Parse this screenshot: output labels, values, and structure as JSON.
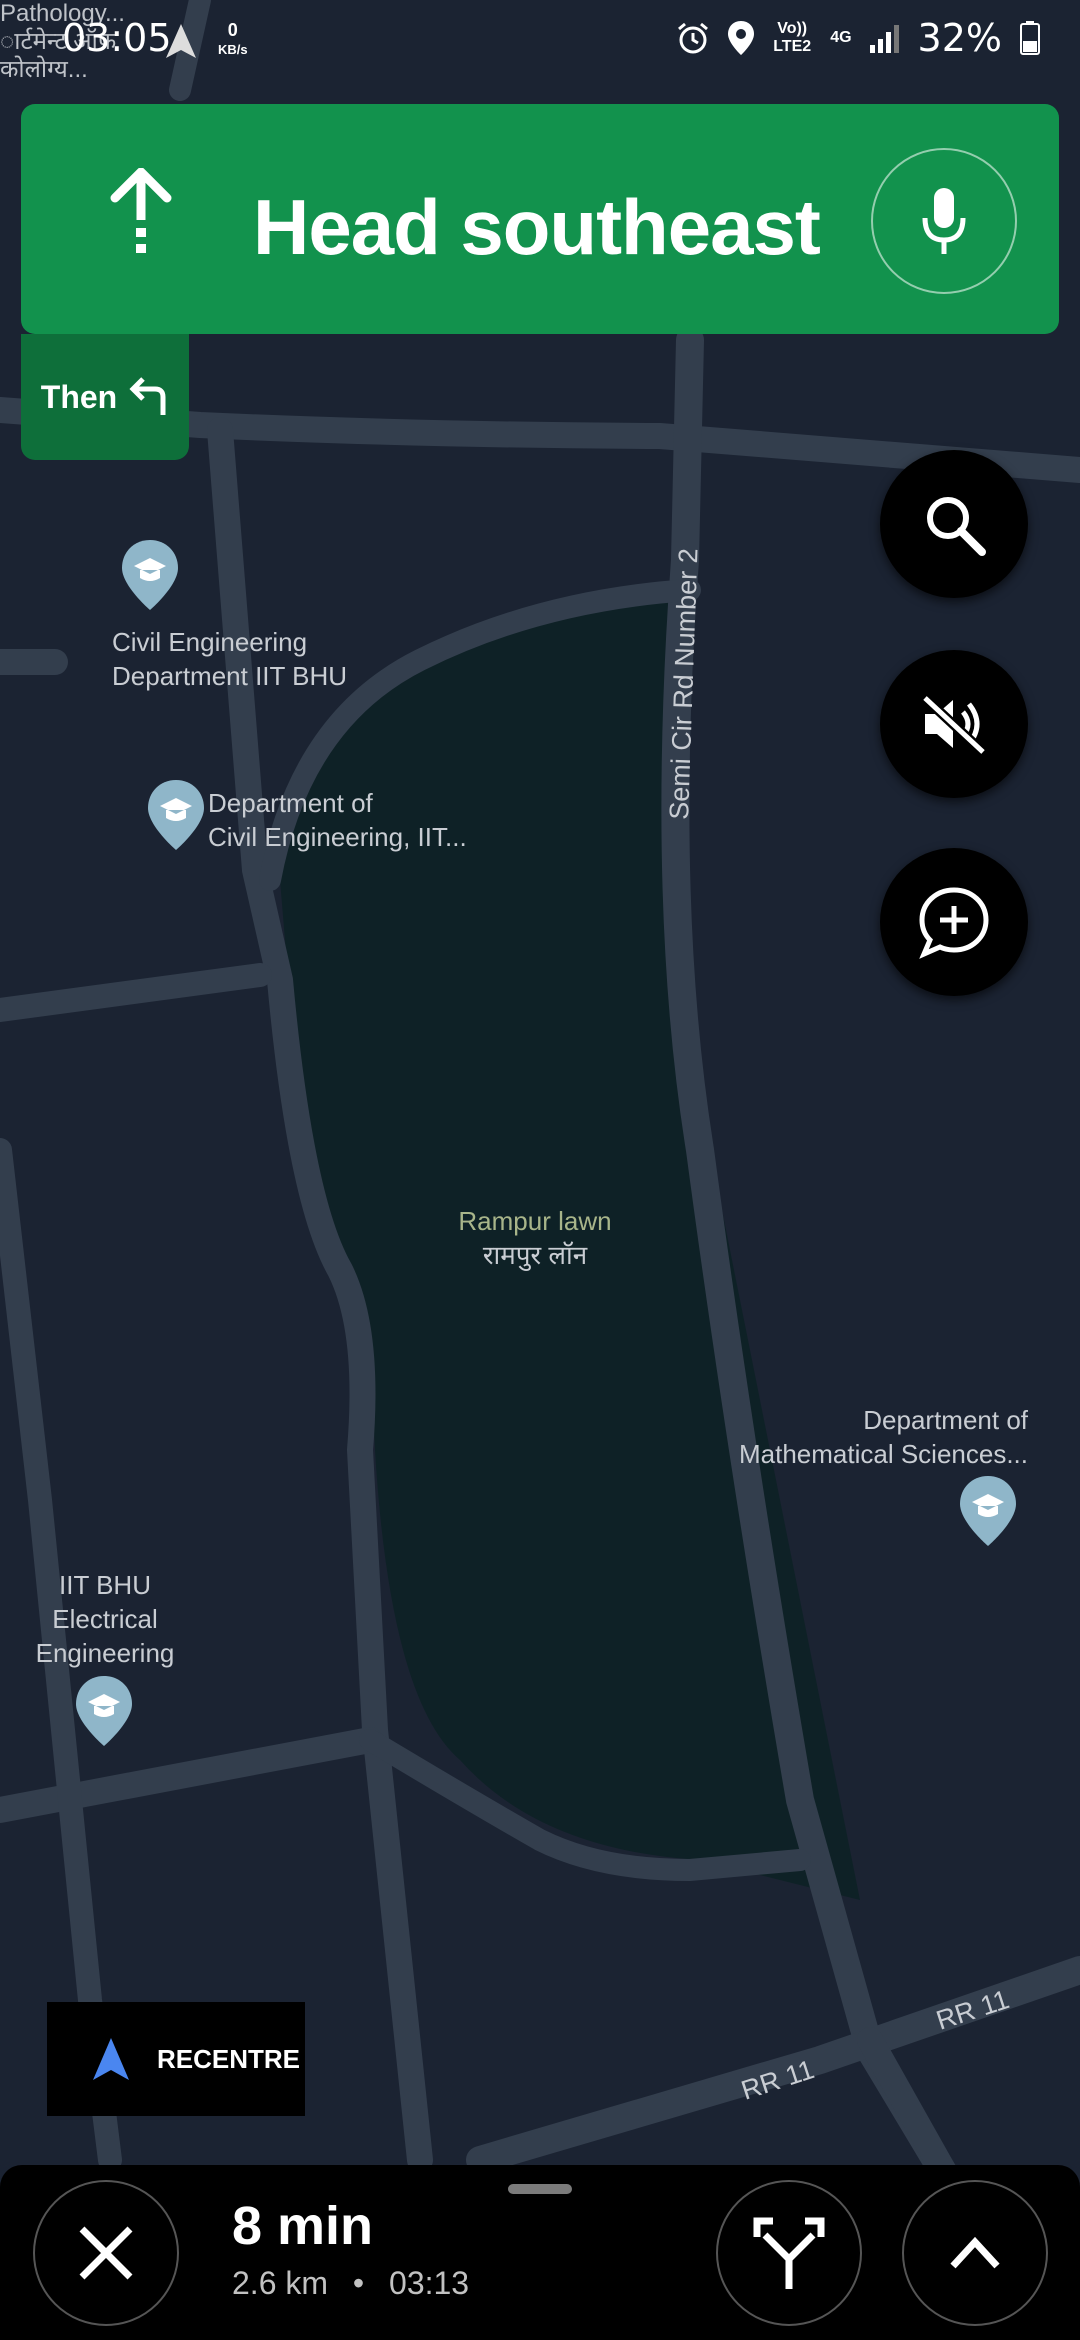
{
  "status_bar": {
    "time": "03:05",
    "speed_value": "0",
    "speed_unit": "KB/s",
    "faded_text": [
      "Pathology...",
      "ार्टमेन्ट ऑफ़",
      "कोलोग्य..."
    ],
    "volte": "Vo)) LTE2",
    "network": "4G",
    "battery": "32%"
  },
  "navigation": {
    "instruction": "Head southeast",
    "then_label": "Then"
  },
  "map": {
    "road_labels": {
      "semi_cir": "Semi Cir Rd Number 2",
      "rr11_a": "RR 11",
      "rr11_b": "RR 11"
    },
    "places": {
      "civil_dept": [
        "Civil Engineering",
        "Department IIT BHU"
      ],
      "dept_civil": [
        "Department of",
        "Civil Engineering, IIT..."
      ],
      "lawn": [
        "Rampur lawn",
        "रामपुर लॉन"
      ],
      "math": [
        "Department of",
        "Mathematical Sciences..."
      ],
      "electrical": [
        "IIT BHU",
        "Electrical",
        "Engineering"
      ]
    }
  },
  "controls": {
    "recentre": "RECENTRE"
  },
  "trip": {
    "duration": "8 min",
    "distance": "2.6 km",
    "separator": "•",
    "arrival": "03:13"
  },
  "icons": {
    "nav": "navigation-arrow-icon",
    "alarm": "alarm-icon",
    "location": "location-pin-icon",
    "signal": "signal-icon",
    "battery": "battery-icon",
    "up_arrow": "straight-arrow-icon",
    "mic": "microphone-icon",
    "turn_left": "turn-left-icon",
    "search": "search-icon",
    "mute": "sound-off-icon",
    "add_report": "add-report-icon",
    "school": "school-icon",
    "close": "close-icon",
    "alt_routes": "alternate-routes-icon",
    "expand": "chevron-up-icon"
  },
  "colors": {
    "banner": "#12924d",
    "then": "#0e6f3a",
    "map_bg": "#1b2332",
    "road": "#333e4d",
    "park": "#0e2126",
    "recentre_arrow": "#4a86f0"
  }
}
